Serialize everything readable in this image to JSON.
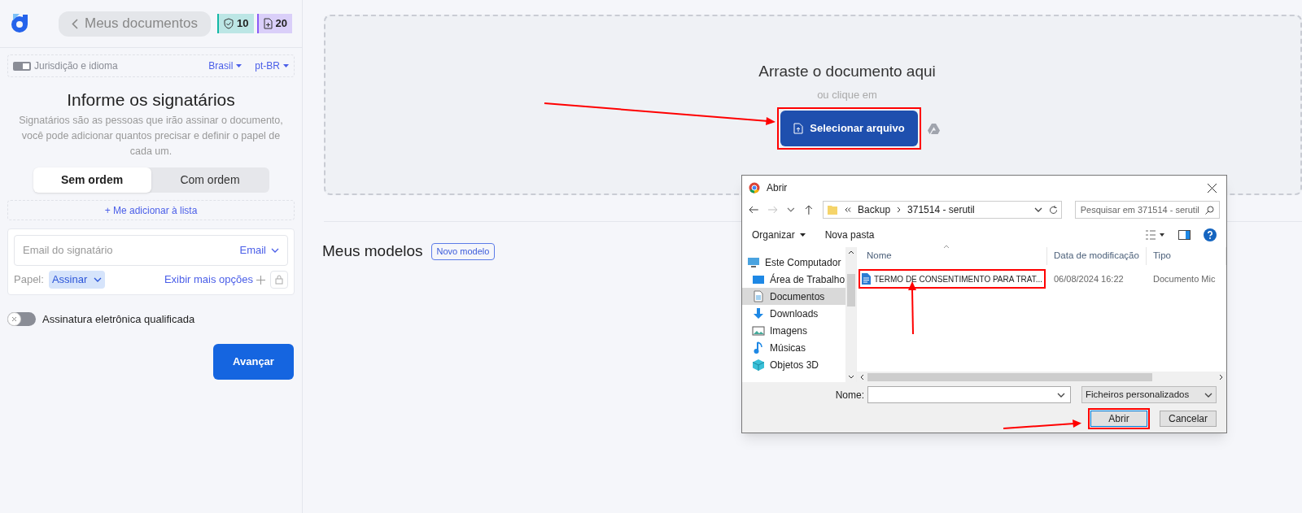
{
  "sidebar": {
    "back_button": "Meus documentos",
    "badges": [
      {
        "kind": "shield",
        "count": "10",
        "color": "#14b8a6"
      },
      {
        "kind": "document",
        "count": "20",
        "color": "#8b5cf6"
      }
    ],
    "jurisdiction": {
      "label": "Jurisdição e idioma",
      "country": "Brasil",
      "language": "pt-BR"
    },
    "title": "Informe os signatários",
    "description": "Signatários são as pessoas que irão assinar o documento, você pode adicionar quantos precisar e definir o papel de cada um.",
    "order_tabs": [
      {
        "label": "Sem ordem",
        "selected": true
      },
      {
        "label": "Com ordem",
        "selected": false
      }
    ],
    "add_me": "+ Me adicionar à lista",
    "signer": {
      "email_placeholder": "Email do signatário",
      "channel": "Email",
      "role_label": "Papel:",
      "role": "Assinar",
      "more_options": "Exibir mais opções"
    },
    "qualified_signature": {
      "label": "Assinatura eletrônica qualificada",
      "on": false
    },
    "next_button": "Avançar"
  },
  "upload": {
    "title": "Arraste o documento aqui",
    "subtitle": "ou clique em",
    "button": "Selecionar arquivo"
  },
  "templates": {
    "title": "Meus modelos",
    "new_button": "Novo modelo"
  },
  "dialog": {
    "title": "Abrir",
    "path": [
      "Backup",
      "371514 - serutil"
    ],
    "search_placeholder": "Pesquisar em 371514 - serutil",
    "toolbar": [
      "Organizar",
      "Nova pasta"
    ],
    "nav": [
      {
        "kind": "computer",
        "label": "Este Computador",
        "selected": false
      },
      {
        "kind": "desktop",
        "label": "Área de Trabalho",
        "selected": false
      },
      {
        "kind": "document",
        "label": "Documentos",
        "selected": true
      },
      {
        "kind": "download",
        "label": "Downloads",
        "selected": false
      },
      {
        "kind": "image",
        "label": "Imagens",
        "selected": false
      },
      {
        "kind": "music",
        "label": "Músicas",
        "selected": false
      },
      {
        "kind": "cube",
        "label": "Objetos 3D",
        "selected": false
      }
    ],
    "columns": [
      "Nome",
      "Data de modificação",
      "Tipo"
    ],
    "files": [
      {
        "name": "TERMO DE CONSENTIMENTO PARA TRAT...",
        "modified": "06/08/2024 16:22",
        "type": "Documento Mic"
      }
    ],
    "name_label": "Nome:",
    "filter": "Ficheiros personalizados",
    "buttons": [
      "Abrir",
      "Cancelar"
    ]
  }
}
